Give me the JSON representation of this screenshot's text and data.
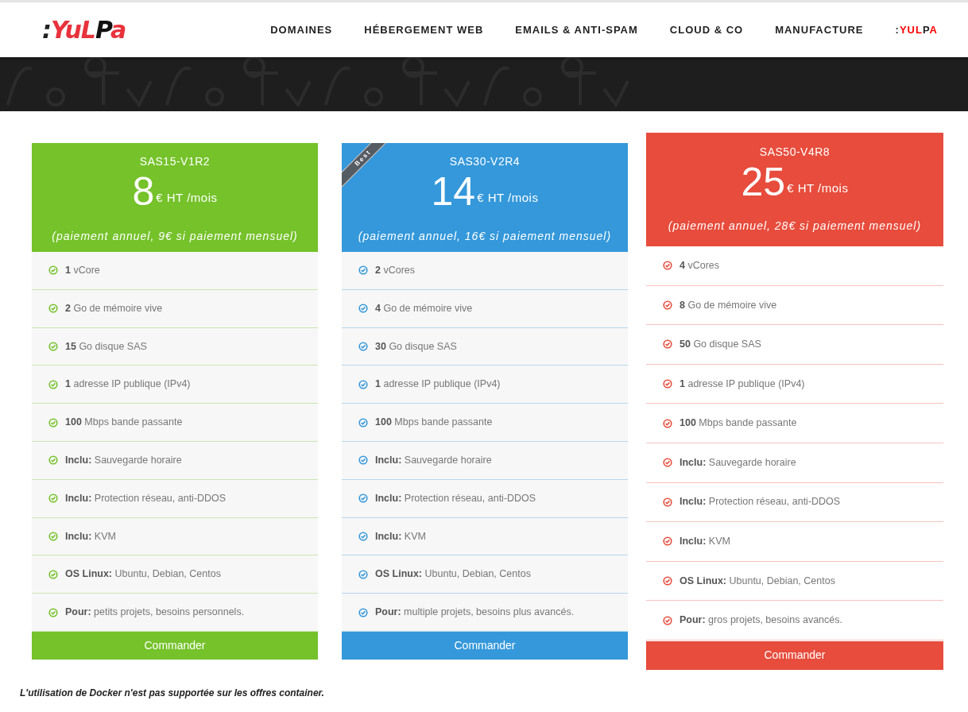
{
  "logo": {
    "parts": [
      {
        "text": ":",
        "color": "#222222"
      },
      {
        "text": "YuL",
        "color": "#e8323c"
      },
      {
        "text": "P",
        "color": "#111111"
      },
      {
        "text": "a",
        "color": "#e8323c"
      }
    ]
  },
  "nav": [
    {
      "kind": "plain",
      "label": "DOMAINES"
    },
    {
      "kind": "plain",
      "label": "HÉBERGEMENT WEB"
    },
    {
      "kind": "plain",
      "label": "EMAILS & ANTI-SPAM"
    },
    {
      "kind": "plain",
      "label": "CLOUD & CO"
    },
    {
      "kind": "plain",
      "label": "MANUFACTURE"
    },
    {
      "kind": "brand",
      "parts": [
        {
          "text": ":"
        },
        {
          "text": "YUL",
          "color": "#ff0000"
        },
        {
          "text": "P"
        },
        {
          "text": "A",
          "color": "#ff0000"
        }
      ]
    }
  ],
  "plans": [
    {
      "name": "SAS15-V1R2",
      "price": "8",
      "unit": "€ HT /mois",
      "note": "(paiement annuel, 9€ si paiement mensuel)",
      "color": "#75c22a",
      "featured": false,
      "features": [
        "**1** vCore",
        "**2** Go de mémoire vive",
        "**15** Go disque SAS",
        "**1** adresse IP publique (IPv4)",
        "**100** Mbps bande passante",
        "**Inclu:** Sauvegarde horaire",
        "**Inclu:** Protection réseau, anti-DDOS",
        "**Inclu:** KVM",
        "**OS Linux:** Ubuntu, Debian, Centos",
        "**Pour:** petits projets, besoins personnels."
      ],
      "button": "Commander"
    },
    {
      "name": "SAS30-V2R4",
      "price": "14",
      "unit": "€ HT /mois",
      "note": "(paiement annuel, 16€ si paiement mensuel)",
      "color": "#3498db",
      "featured": false,
      "ribbon": "Best",
      "features": [
        "**2** vCores",
        "**4** Go de mémoire vive",
        "**30** Go disque SAS",
        "**1** adresse IP publique (IPv4)",
        "**100** Mbps bande passante",
        "**Inclu:** Sauvegarde horaire",
        "**Inclu:** Protection réseau, anti-DDOS",
        "**Inclu:** KVM",
        "**OS Linux:** Ubuntu, Debian, Centos",
        "**Pour:** multiple projets, besoins plus avancés."
      ],
      "button": "Commander"
    },
    {
      "name": "SAS50-V4R8",
      "price": "25",
      "unit": "€ HT /mois",
      "note": "(paiement annuel, 28€ si paiement mensuel)",
      "color": "#e74c3c",
      "featured": true,
      "features": [
        "**4** vCores",
        "**8** Go de mémoire vive",
        "**50** Go disque SAS",
        "**1** adresse IP publique (IPv4)",
        "**100** Mbps bande passante",
        "**Inclu:** Sauvegarde horaire",
        "**Inclu:** Protection réseau, anti-DDOS",
        "**Inclu:** KVM",
        "**OS Linux:** Ubuntu, Debian, Centos",
        "**Pour:** gros projets, besoins avancés."
      ],
      "button": "Commander"
    }
  ],
  "footnote": "L'utilisation de Docker n'est pas supportée sur les offres container."
}
